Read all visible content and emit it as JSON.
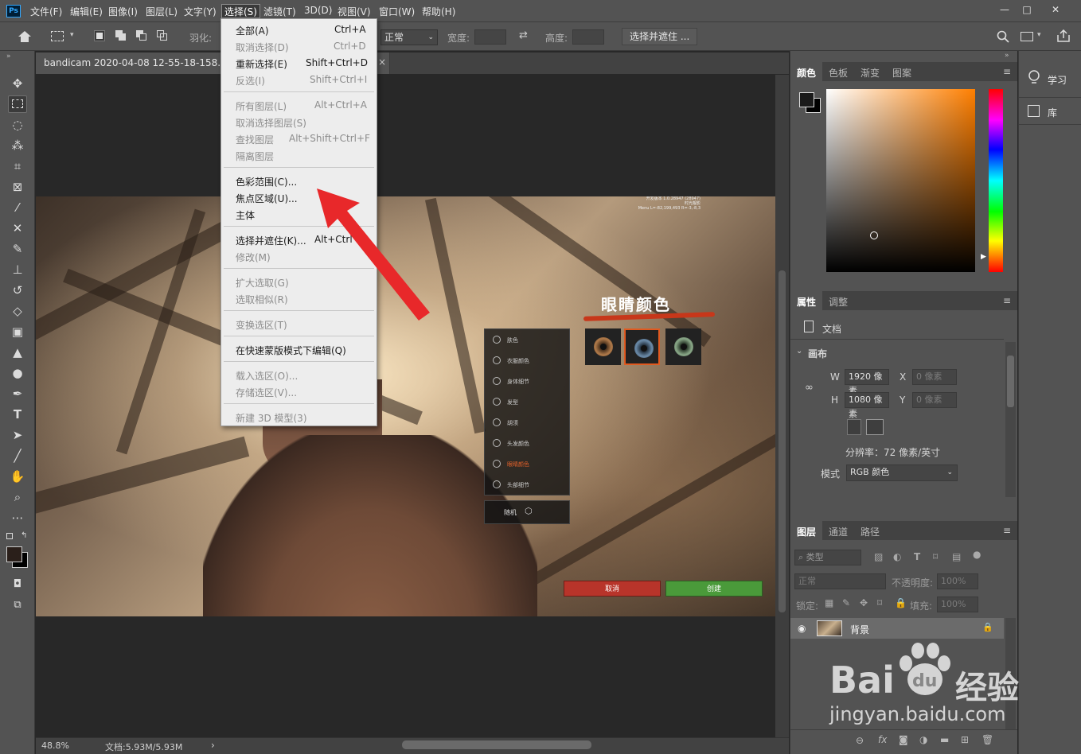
{
  "app": {
    "logo": "Ps"
  },
  "menubar": {
    "items": [
      "文件(F)",
      "编辑(E)",
      "图像(I)",
      "图层(L)",
      "文字(Y)",
      "选择(S)",
      "滤镜(T)",
      "3D(D)",
      "视图(V)",
      "窗口(W)",
      "帮助(H)"
    ],
    "window_controls": [
      "—",
      "□",
      "✕"
    ]
  },
  "options_bar": {
    "feather_label": "羽化:",
    "style_value": "正常",
    "width_label": "宽度:",
    "height_label": "高度:",
    "select_mask_button": "选择并遮住 ..."
  },
  "document": {
    "tab_title": "bandicam 2020-04-08 12-55-18-158.00_0",
    "tab_close": "×"
  },
  "game": {
    "hud_lines": [
      "开发版本 1.0.28947 (28947)",
      "时光靓影",
      "Menu L=-82,199,493 R=-3,-8,3"
    ],
    "title": "眼睛颜色",
    "menu_items": [
      "肤色",
      "衣服颜色",
      "身体细节",
      "发型",
      "胡须",
      "头发颜色",
      "眼睛颜色",
      "头部细节"
    ],
    "random_label": "随机",
    "cancel_label": "取消",
    "create_label": "创建"
  },
  "select_menu": {
    "items": [
      {
        "label": "全部(A)",
        "shortcut": "Ctrl+A",
        "enabled": true
      },
      {
        "label": "取消选择(D)",
        "shortcut": "Ctrl+D",
        "enabled": false
      },
      {
        "label": "重新选择(E)",
        "shortcut": "Shift+Ctrl+D",
        "enabled": true
      },
      {
        "label": "反选(I)",
        "shortcut": "Shift+Ctrl+I",
        "enabled": false
      },
      {
        "label": "所有图层(L)",
        "shortcut": "Alt+Ctrl+A",
        "enabled": false
      },
      {
        "label": "取消选择图层(S)",
        "shortcut": "",
        "enabled": false
      },
      {
        "label": "查找图层",
        "shortcut": "Alt+Shift+Ctrl+F",
        "enabled": false
      },
      {
        "label": "隔离图层",
        "shortcut": "",
        "enabled": false
      },
      {
        "label": "色彩范围(C)...",
        "shortcut": "",
        "enabled": true
      },
      {
        "label": "焦点区域(U)...",
        "shortcut": "",
        "enabled": true
      },
      {
        "label": "主体",
        "shortcut": "",
        "enabled": true
      },
      {
        "label": "选择并遮住(K)...",
        "shortcut": "Alt+Ctrl",
        "enabled": true
      },
      {
        "label": "修改(M)",
        "shortcut": "",
        "enabled": false
      },
      {
        "label": "扩大选取(G)",
        "shortcut": "",
        "enabled": false
      },
      {
        "label": "选取相似(R)",
        "shortcut": "",
        "enabled": false
      },
      {
        "label": "变换选区(T)",
        "shortcut": "",
        "enabled": false
      },
      {
        "label": "在快速蒙版模式下编辑(Q)",
        "shortcut": "",
        "enabled": true
      },
      {
        "label": "载入选区(O)...",
        "shortcut": "",
        "enabled": false
      },
      {
        "label": "存储选区(V)...",
        "shortcut": "",
        "enabled": false
      },
      {
        "label": "新建 3D 模型(3)",
        "shortcut": "",
        "enabled": false
      }
    ]
  },
  "status_bar": {
    "zoom": "48.8%",
    "doc_info": "文档:5.93M/5.93M",
    "nav_arrow": "›"
  },
  "color_panel": {
    "tabs": [
      "颜色",
      "色板",
      "渐变",
      "图案"
    ],
    "foreground": "#1a1a1a",
    "background": "#000000",
    "field_hue": "#ff7f00"
  },
  "properties_panel": {
    "tabs": [
      "属性",
      "调整"
    ],
    "doc_label": "文档",
    "section": "画布",
    "w_label": "W",
    "w_value": "1920 像素",
    "h_label": "H",
    "h_value": "1080 像素",
    "x_label": "X",
    "x_placeholder": "0 像素",
    "y_label": "Y",
    "y_placeholder": "0 像素",
    "resolution": "分辨率：72 像素/英寸",
    "mode_label": "模式",
    "mode_value": "RGB 颜色"
  },
  "layers_panel": {
    "tabs": [
      "图层",
      "通道",
      "路径"
    ],
    "filter_kind": "类型",
    "blend_mode": "正常",
    "opacity_label": "不透明度:",
    "opacity_value": "100%",
    "lock_label": "锁定:",
    "fill_label": "填充:",
    "fill_value": "100%",
    "layer_name": "背景",
    "footer_icons": [
      "link-icon",
      "fx",
      "mask-icon",
      "adjustment-icon",
      "folder-icon",
      "new-layer-icon",
      "trash-icon"
    ],
    "fx_label": "fx"
  },
  "far_right": {
    "items": [
      "学习",
      "库"
    ]
  },
  "watermark": {
    "brand": "Bai",
    "du": "du",
    "product": "经验",
    "url": "jingyan.baidu.com"
  }
}
